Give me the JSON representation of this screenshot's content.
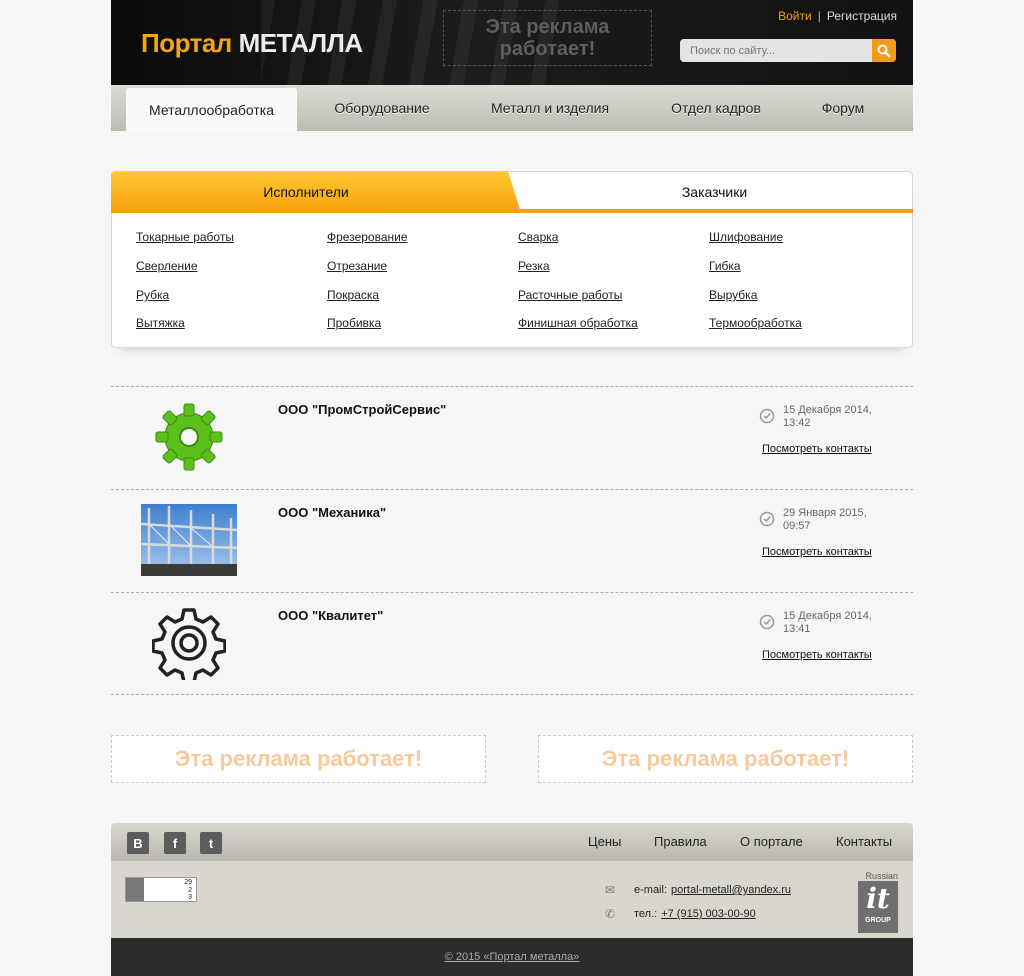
{
  "header": {
    "logo_part1": "Портал",
    "logo_part2": "МЕТАЛЛА",
    "ad_text": "Эта реклама работает!",
    "login": "Войти",
    "separator": "|",
    "register": "Регистрация",
    "search_placeholder": "Поиск по сайту...",
    "accent_color": "#f39b17"
  },
  "nav": {
    "items": [
      {
        "label": "Металлообработка",
        "active": true
      },
      {
        "label": "Оборудование"
      },
      {
        "label": "Металл и изделия"
      },
      {
        "label": "Отдел кадров"
      },
      {
        "label": "Форум"
      }
    ]
  },
  "tabs": {
    "left": "Исполнители",
    "right": "Заказчики",
    "columns": [
      [
        "Токарные работы",
        "Сверление",
        "Рубка",
        "Вытяжка"
      ],
      [
        "Фрезерование",
        "Отрезание",
        "Покраска",
        "Пробивка"
      ],
      [
        "Сварка",
        "Резка",
        "Расточные работы",
        "Финишная обработка"
      ],
      [
        "Шлифование",
        "Гибка",
        "Вырубка",
        "Термообработка"
      ]
    ]
  },
  "listings": [
    {
      "name": "ООО \"ПромСтройСервис\"",
      "date": "15 Декабря 2014,",
      "time": "13:42",
      "link": "Посмотреть контакты",
      "thumb": "green-gear-icon"
    },
    {
      "name": "ООО \"Механика\"",
      "date": "29 Января 2015,",
      "time": "09:57",
      "link": "Посмотреть контакты",
      "thumb": "steel-structure-photo"
    },
    {
      "name": "ООО \"Квалитет\"",
      "date": "15 Декабря 2014,",
      "time": "13:41",
      "link": "Посмотреть контакты",
      "thumb": "outline-gear-icon"
    }
  ],
  "ads": {
    "left": "Эта реклама работает!",
    "right": "Эта реклама работает!"
  },
  "footer": {
    "social": [
      "В",
      "f",
      "t"
    ],
    "nav": [
      "Цены",
      "Правила",
      "О портале",
      "Контакты"
    ],
    "counter": [
      "29",
      "2",
      "3"
    ],
    "email_label": "e-mail:",
    "email": "portal-metall@yandex.ru",
    "phone_label": "тел.:",
    "phone": "+7 (915) 003-00-90",
    "it_top": "Russian",
    "it_main": "it",
    "it_group": "GROUP",
    "copyright": "© 2015 «Портал металла»"
  }
}
